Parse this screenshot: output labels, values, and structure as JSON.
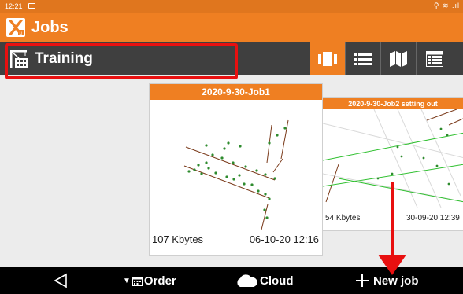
{
  "status_bar": {
    "time": "12:21",
    "system_icons": "⚲ ≋ .ıl"
  },
  "app": {
    "title": "Jobs",
    "logo_icon": "xpad-logo-icon",
    "accent": "#ef7f22"
  },
  "workspace": {
    "name": "Training",
    "icon": "building-crane-icon"
  },
  "view_modes": [
    {
      "icon": "cards-view-icon",
      "selected": true
    },
    {
      "icon": "list-view-icon",
      "selected": false
    },
    {
      "icon": "map-view-icon",
      "selected": false
    },
    {
      "icon": "grid-view-icon",
      "selected": false
    }
  ],
  "jobs": [
    {
      "name": "2020-9-30-Job1",
      "size": "107 Kbytes",
      "date": "06-10-20 12:16"
    },
    {
      "name": "2020-9-30-Job2  setting out",
      "size": "54 Kbytes",
      "date": "30-09-20 12:39"
    }
  ],
  "bottom_bar": {
    "back_icon": "back-triangle-icon",
    "order_label": "Order",
    "cloud_label": "Cloud",
    "new_job_label": "New job"
  },
  "annotation_color": "#e81010"
}
